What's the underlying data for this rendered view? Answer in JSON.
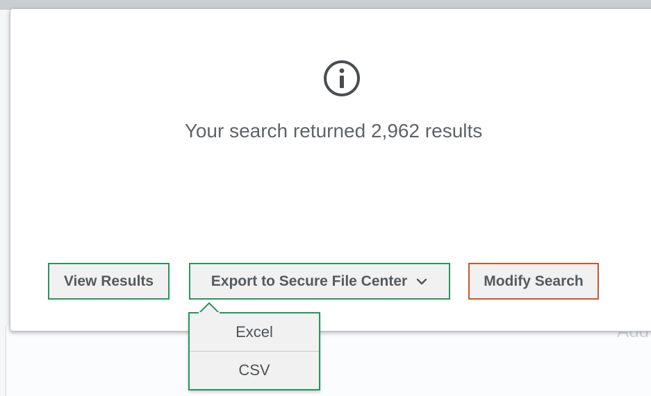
{
  "background": {
    "faded_text": "Add"
  },
  "modal": {
    "icon": "info-circle-icon",
    "message": "Your search returned 2,962 results",
    "buttons": {
      "view_results": "View Results",
      "export": "Export to Secure File Center",
      "export_icon": "chevron-down-icon",
      "modify_search": "Modify Search"
    },
    "export_menu": {
      "items": [
        "Excel",
        "CSV"
      ]
    }
  },
  "colors": {
    "primary_border": "#23975f",
    "secondary_border": "#c8572a",
    "button_bg": "#f1f1f1",
    "text": "#555a5e"
  }
}
